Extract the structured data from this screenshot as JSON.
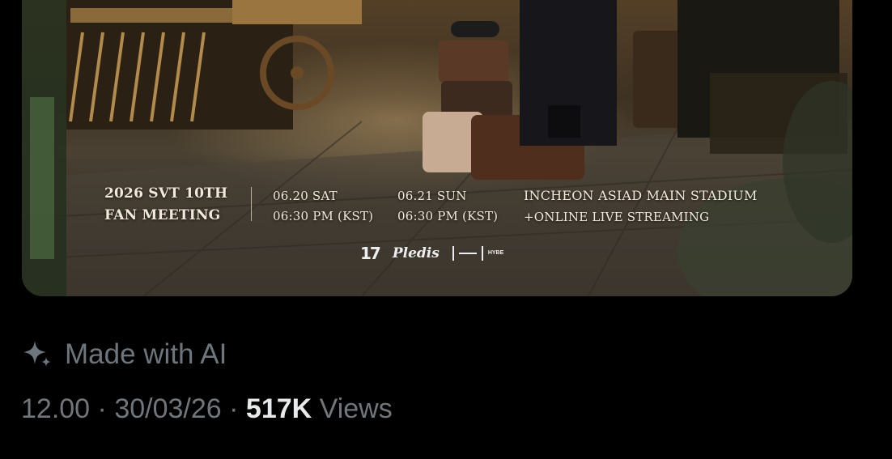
{
  "poster": {
    "event_title_line1": "2026 SVT 10TH",
    "event_title_line2": "FAN MEETING",
    "day1_date": "06.20 SAT",
    "day1_time": "06:30 PM (KST)",
    "day2_date": "06.21 SUN",
    "day2_time": "06:30 PM (KST)",
    "venue": "INCHEON ASIAD MAIN STADIUM",
    "streaming": "+ONLINE LIVE STREAMING",
    "logos": {
      "svt": "17",
      "pledis": "Pledis",
      "hybe": "HYBE"
    }
  },
  "ai_label": {
    "icon": "sparkle-icon",
    "text": "Made with AI"
  },
  "post_meta": {
    "time": "12.00",
    "separator": "·",
    "date": "30/03/26",
    "views_count": "517K",
    "views_label": "Views"
  },
  "colors": {
    "background": "#000000",
    "meta_text": "#71767b",
    "emphasis_text": "#e7e9ea"
  }
}
